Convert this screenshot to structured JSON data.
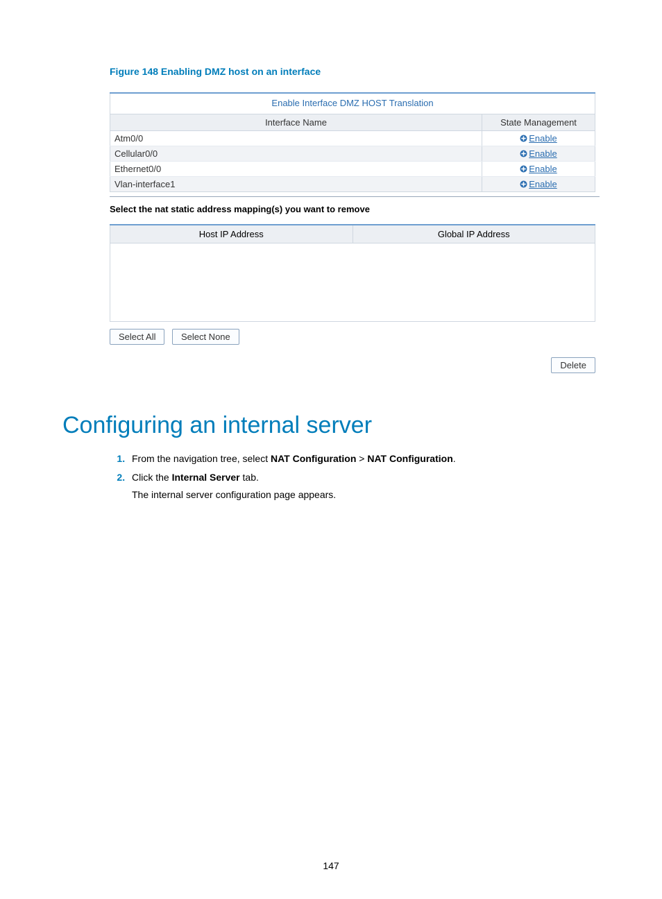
{
  "figure": {
    "label": "Figure 148 Enabling DMZ host on an interface",
    "table_title": "Enable Interface DMZ HOST Translation",
    "col_interface": "Interface Name",
    "col_state": "State Management",
    "rows": [
      {
        "name": "Atm0/0",
        "action": "Enable"
      },
      {
        "name": "Cellular0/0",
        "action": "Enable"
      },
      {
        "name": "Ethernet0/0",
        "action": "Enable"
      },
      {
        "name": "Vlan-interface1",
        "action": "Enable"
      }
    ],
    "remove_title": "Select the nat static address mapping(s) you want to remove",
    "col_host_ip": "Host IP Address",
    "col_global_ip": "Global IP Address",
    "btn_select_all": "Select All",
    "btn_select_none": "Select None",
    "btn_delete": "Delete"
  },
  "section_title": "Configuring an internal server",
  "steps": {
    "s1_pre": "From the navigation tree, select ",
    "s1_b1": "NAT Configuration",
    "s1_mid": " > ",
    "s1_b2": "NAT Configuration",
    "s1_post": ".",
    "s2_pre": "Click the ",
    "s2_b1": "Internal Server",
    "s2_post": " tab.",
    "s2_sub": "The internal server configuration page appears."
  },
  "page_number": "147"
}
